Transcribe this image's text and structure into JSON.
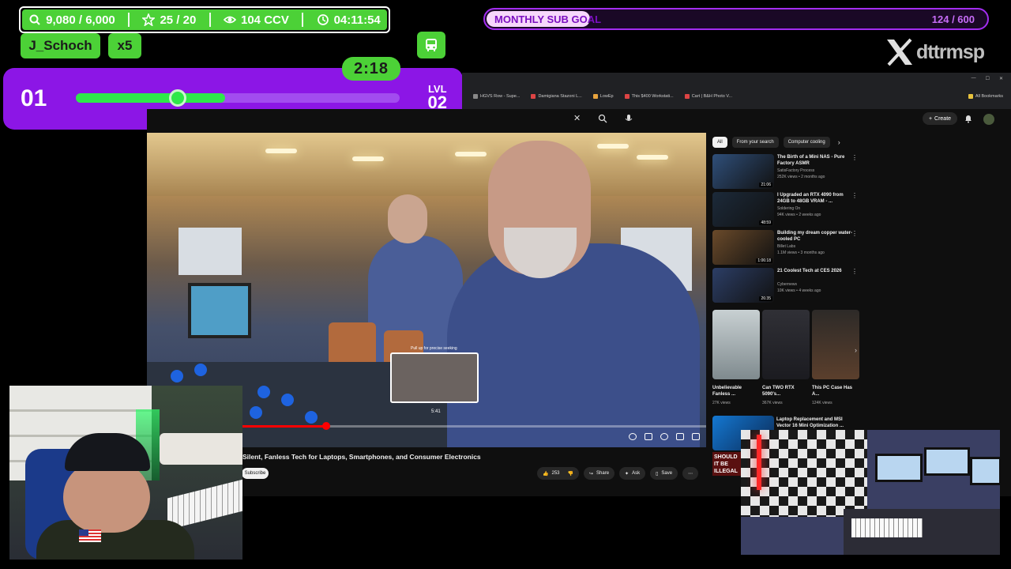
{
  "overlay": {
    "stats": {
      "followers": "9,080 / 6,000",
      "stars": "25 / 20",
      "viewers": "104 CCV",
      "uptime": "04:11:54"
    },
    "latest_user": "J_Schoch",
    "multiplier": "x5",
    "level": {
      "current": "01",
      "next_label": "LVL",
      "next": "02",
      "progress_value": "25",
      "progress_fraction": 0.25,
      "timer": "2:18"
    },
    "sub_goal": {
      "label": "MONTHLY SUB GOAL",
      "count": "124 / 600",
      "fraction": 0.2067
    },
    "brand_handle": "dttrmsp",
    "colors": {
      "green": "#4cd137",
      "purple": "#8c16e6",
      "goal_border": "#a32df0"
    }
  },
  "browser": {
    "bookmarks": [
      "HGVS Row - Supe...",
      "Damigiana Stazoni L...",
      "LowEp",
      "This $400 Workstati...",
      "Cart | B&H Photo V...",
      "All Bookmarks"
    ]
  },
  "youtube": {
    "create_label": "Create",
    "video_title": "Silent, Fanless Tech for Laptops, Smartphones, and Consumer Electronics",
    "subscribe_label": "Subscribe",
    "seek_hint": "Pull up for precise seeking",
    "seek_time": "5:41",
    "progress_fraction": 0.32,
    "actions": {
      "likes": "253",
      "share": "Share",
      "ask": "Ask",
      "save": "Save"
    },
    "chips": [
      "All",
      "From your search",
      "Computer cooling"
    ],
    "recommendations": [
      {
        "title": "The Birth of a Mini NAS - Pure Factory ASMR",
        "channel": "SatisFactory Process",
        "meta": "252K views • 2 months ago",
        "duration": "21:06",
        "color": "#2f4f7a"
      },
      {
        "title": "I Upgraded an RTX 4090 from 24GB to 48GB VRAM - ...",
        "channel": "Soldering On",
        "meta": "94K views • 2 weeks ago",
        "duration": "48:59",
        "color": "#1c2a3a"
      },
      {
        "title": "Building my dream copper water-cooled PC",
        "channel": "Billet Labs",
        "meta": "1.1M views • 3 months ago",
        "duration": "1:06:18",
        "color": "#6a4a2a"
      },
      {
        "title": "21 Coolest Tech at CES 2026",
        "channel": "Cybernews",
        "meta": "10K views • 4 weeks ago",
        "duration": "26:35",
        "color": "#2c3e66"
      }
    ],
    "shorts": [
      {
        "title": "Unbelievable Fanless ...",
        "views": "27K views",
        "color": "#a9b4b8"
      },
      {
        "title": "Can TWO RTX 5090's...",
        "views": "367K views",
        "color": "#2a2a30"
      },
      {
        "title": "This PC Case Has A...",
        "views": "124K views",
        "color": "#3a3230"
      }
    ],
    "last_rec_title": "Laptop Replacement and MSI Vector 16 Mini Optimization ...",
    "last_rec_thumb_text": "SHOULD IT BE ILLEGAL"
  }
}
